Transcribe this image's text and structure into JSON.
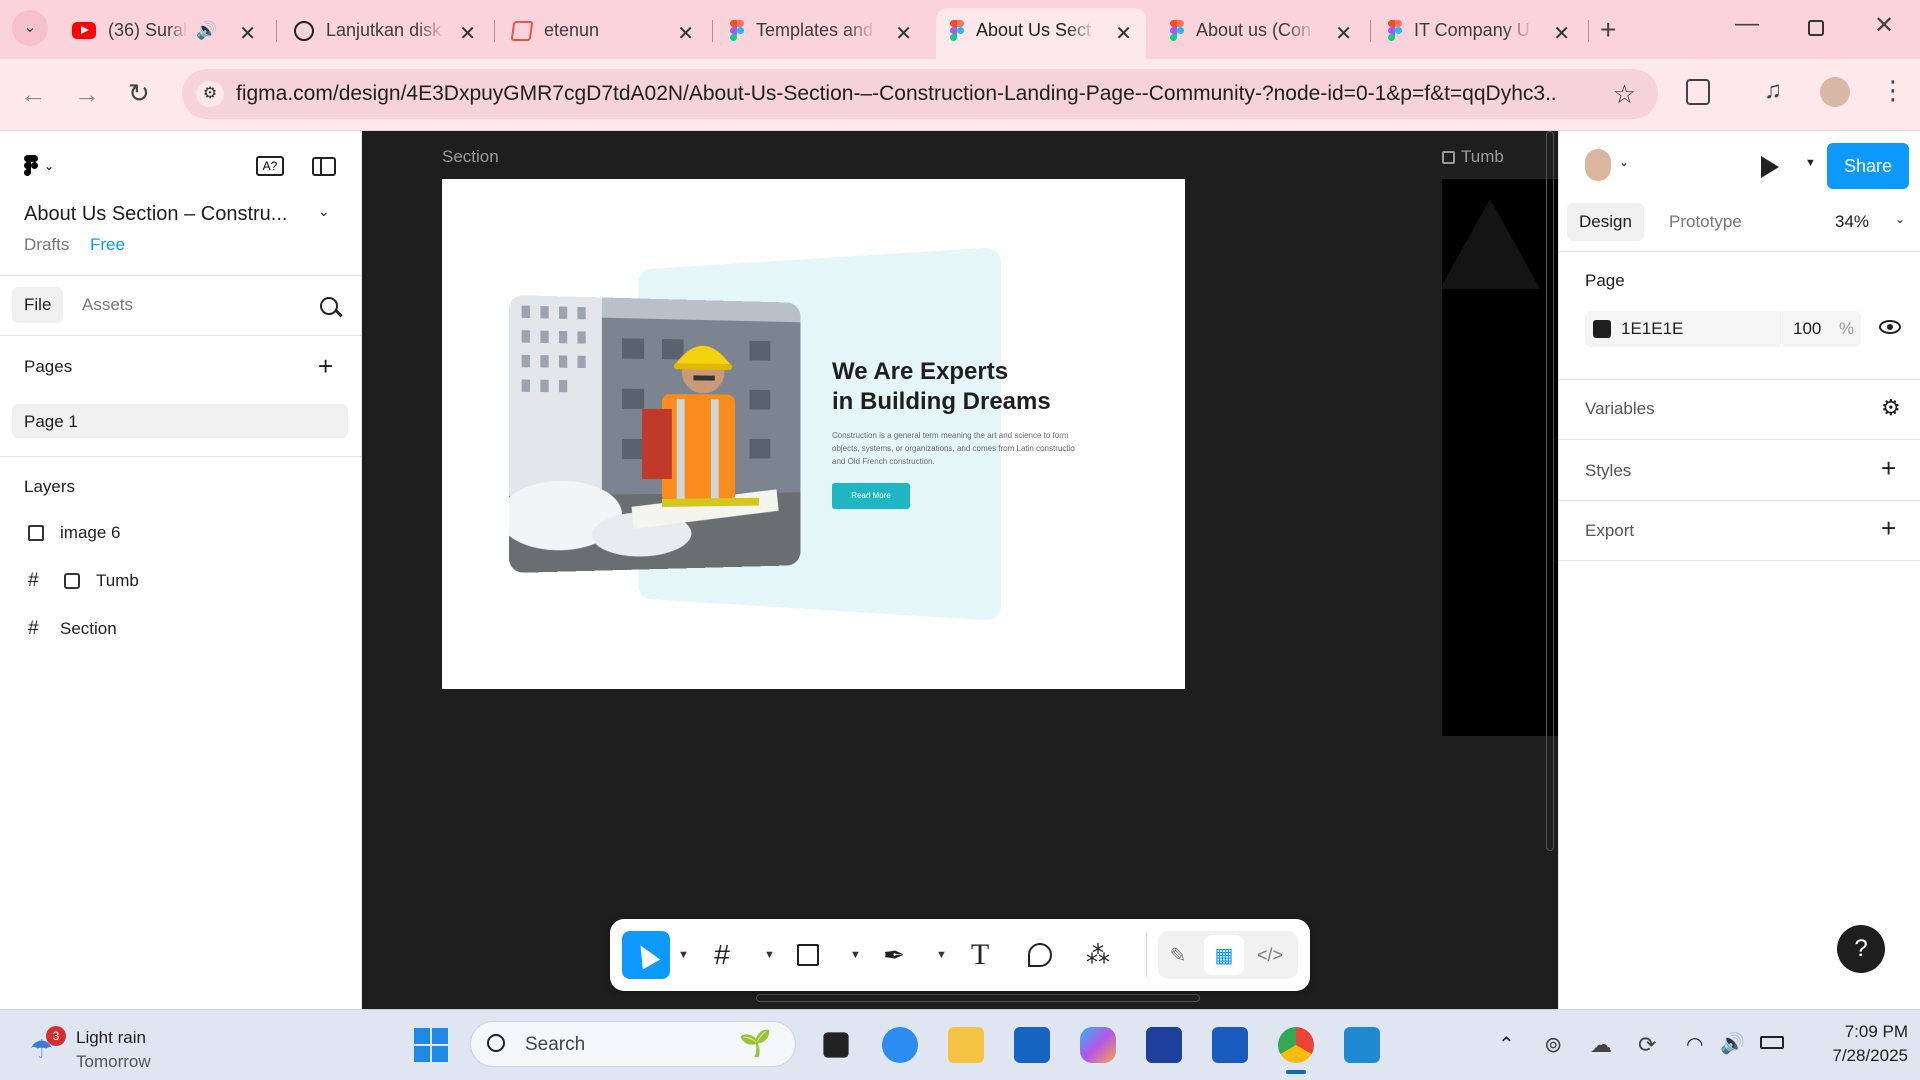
{
  "browser": {
    "tabs": [
      {
        "label": "(36) Surah",
        "icon": "youtube-icon"
      },
      {
        "label": "Lanjutkan disk",
        "icon": "chatgpt-icon"
      },
      {
        "label": "etenun",
        "icon": "laravel-icon"
      },
      {
        "label": "Templates and",
        "icon": "figma-icon"
      },
      {
        "label": "About Us Sect",
        "icon": "figma-icon",
        "active": true
      },
      {
        "label": "About us (Con",
        "icon": "figma-icon"
      },
      {
        "label": "IT Company U",
        "icon": "figma-icon"
      }
    ],
    "url": "figma.com/design/4E3DxpuyGMR7cgD7tdA02N/About-Us-Section-–-Construction-Landing-Page--Community-?node-id=0-1&p=f&t=qqDyhc3..."
  },
  "figma": {
    "file_title": "About Us Section – Constru...",
    "drafts_label": "Drafts",
    "plan_label": "Free",
    "tab_file": "File",
    "tab_assets": "Assets",
    "pages_heading": "Pages",
    "pages": [
      "Page 1"
    ],
    "layers_heading": "Layers",
    "layers": [
      {
        "name": "image 6",
        "icon": "image-icon"
      },
      {
        "name": "Tumb",
        "icon": "frame-icon"
      },
      {
        "name": "Section",
        "icon": "frame-icon"
      }
    ],
    "canvas": {
      "frame_label_section": "Section",
      "frame_label_tumb": "Tumb",
      "heading_line1": "We Are Experts",
      "heading_line2": "in Building Dreams",
      "body_text": "Construction is a general term meaning the art and science to form objects, systems, or organizations, and comes from Latin constructio and Old French construction.",
      "cta_label": "Read More"
    },
    "right_panel": {
      "share_label": "Share",
      "tab_design": "Design",
      "tab_prototype": "Prototype",
      "zoom": "34%",
      "page_heading": "Page",
      "page_color_hex": "1E1E1E",
      "page_opacity": "100",
      "percent_sign": "%",
      "variables_label": "Variables",
      "styles_label": "Styles",
      "export_label": "Export",
      "help_label": "?"
    }
  },
  "taskbar": {
    "weather_badge": "3",
    "weather_title": "Light rain",
    "weather_sub": "Tomorrow",
    "search_placeholder": "Search",
    "time": "7:09 PM",
    "date": "7/28/2025"
  },
  "colors": {
    "teal_accent": "#1fb5c2",
    "figma_blue": "#0d99ff",
    "tab_bar": "#fbd3db",
    "canvas_bg": "#1e1e1e"
  }
}
